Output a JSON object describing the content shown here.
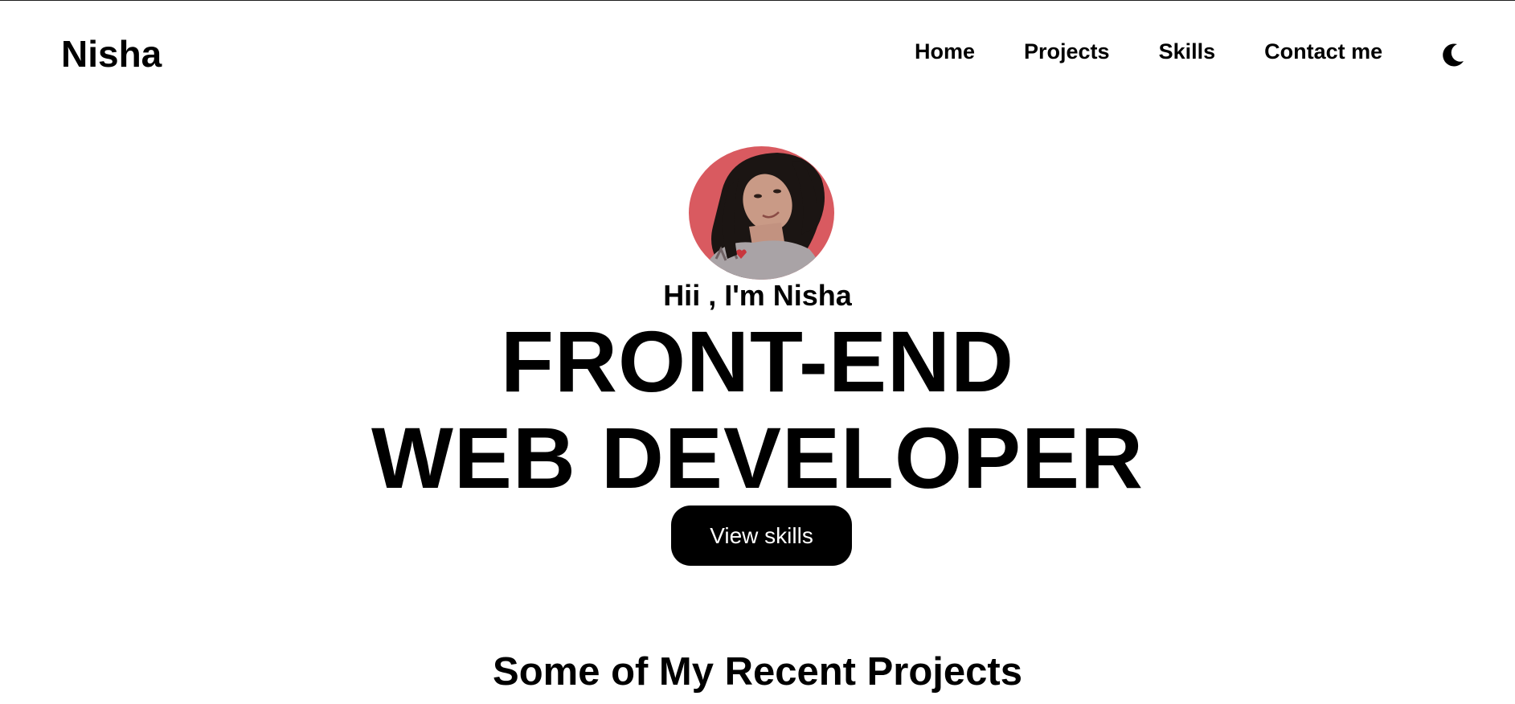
{
  "brand": {
    "name": "Nisha"
  },
  "nav": {
    "items": [
      {
        "label": "Home"
      },
      {
        "label": "Projects"
      },
      {
        "label": "Skills"
      },
      {
        "label": "Contact me"
      }
    ],
    "theme_toggle_icon": "moon-icon"
  },
  "hero": {
    "avatar_icon": "profile-photo",
    "greeting": "Hii , I'm Nisha",
    "title_line1": "FRONT-END",
    "title_line2": "WEB DEVELOPER",
    "cta_label": "View skills"
  },
  "projects": {
    "heading": "Some of My Recent Projects"
  },
  "colors": {
    "background": "#ffffff",
    "text": "#000000",
    "button_bg": "#000000",
    "button_text": "#ffffff",
    "avatar_bg": "#d95a60"
  }
}
